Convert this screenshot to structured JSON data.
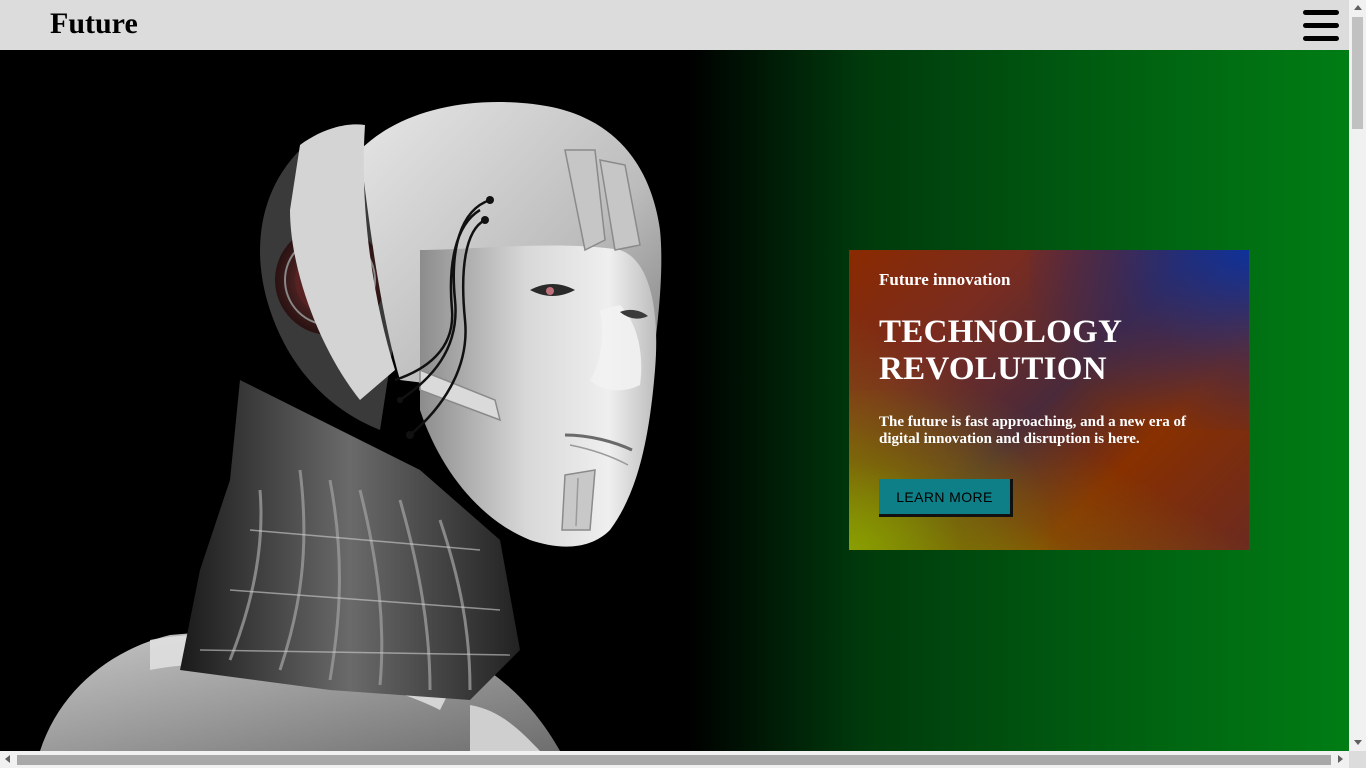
{
  "navbar": {
    "brand": "Future",
    "menu_icon": "hamburger-menu-icon"
  },
  "hero": {
    "image": "robot-head-illustration",
    "card": {
      "eyebrow": "Future innovation",
      "headline_line1": "TECHNOLOGY",
      "headline_line2": "REVOLUTION",
      "lead": "The future is fast approaching, and a new era of digital innovation and disruption is here.",
      "cta_label": "LEARN MORE"
    }
  },
  "colors": {
    "navbar_bg": "#dcdcdc",
    "hero_gradient_end": "#007d14",
    "cta_bg": "#0e7f86"
  },
  "scrollbars": {
    "vertical_icon_up": "scroll-up-arrow-icon",
    "vertical_icon_down": "scroll-down-arrow-icon",
    "horizontal_icon_left": "scroll-left-arrow-icon",
    "horizontal_icon_right": "scroll-right-arrow-icon"
  }
}
